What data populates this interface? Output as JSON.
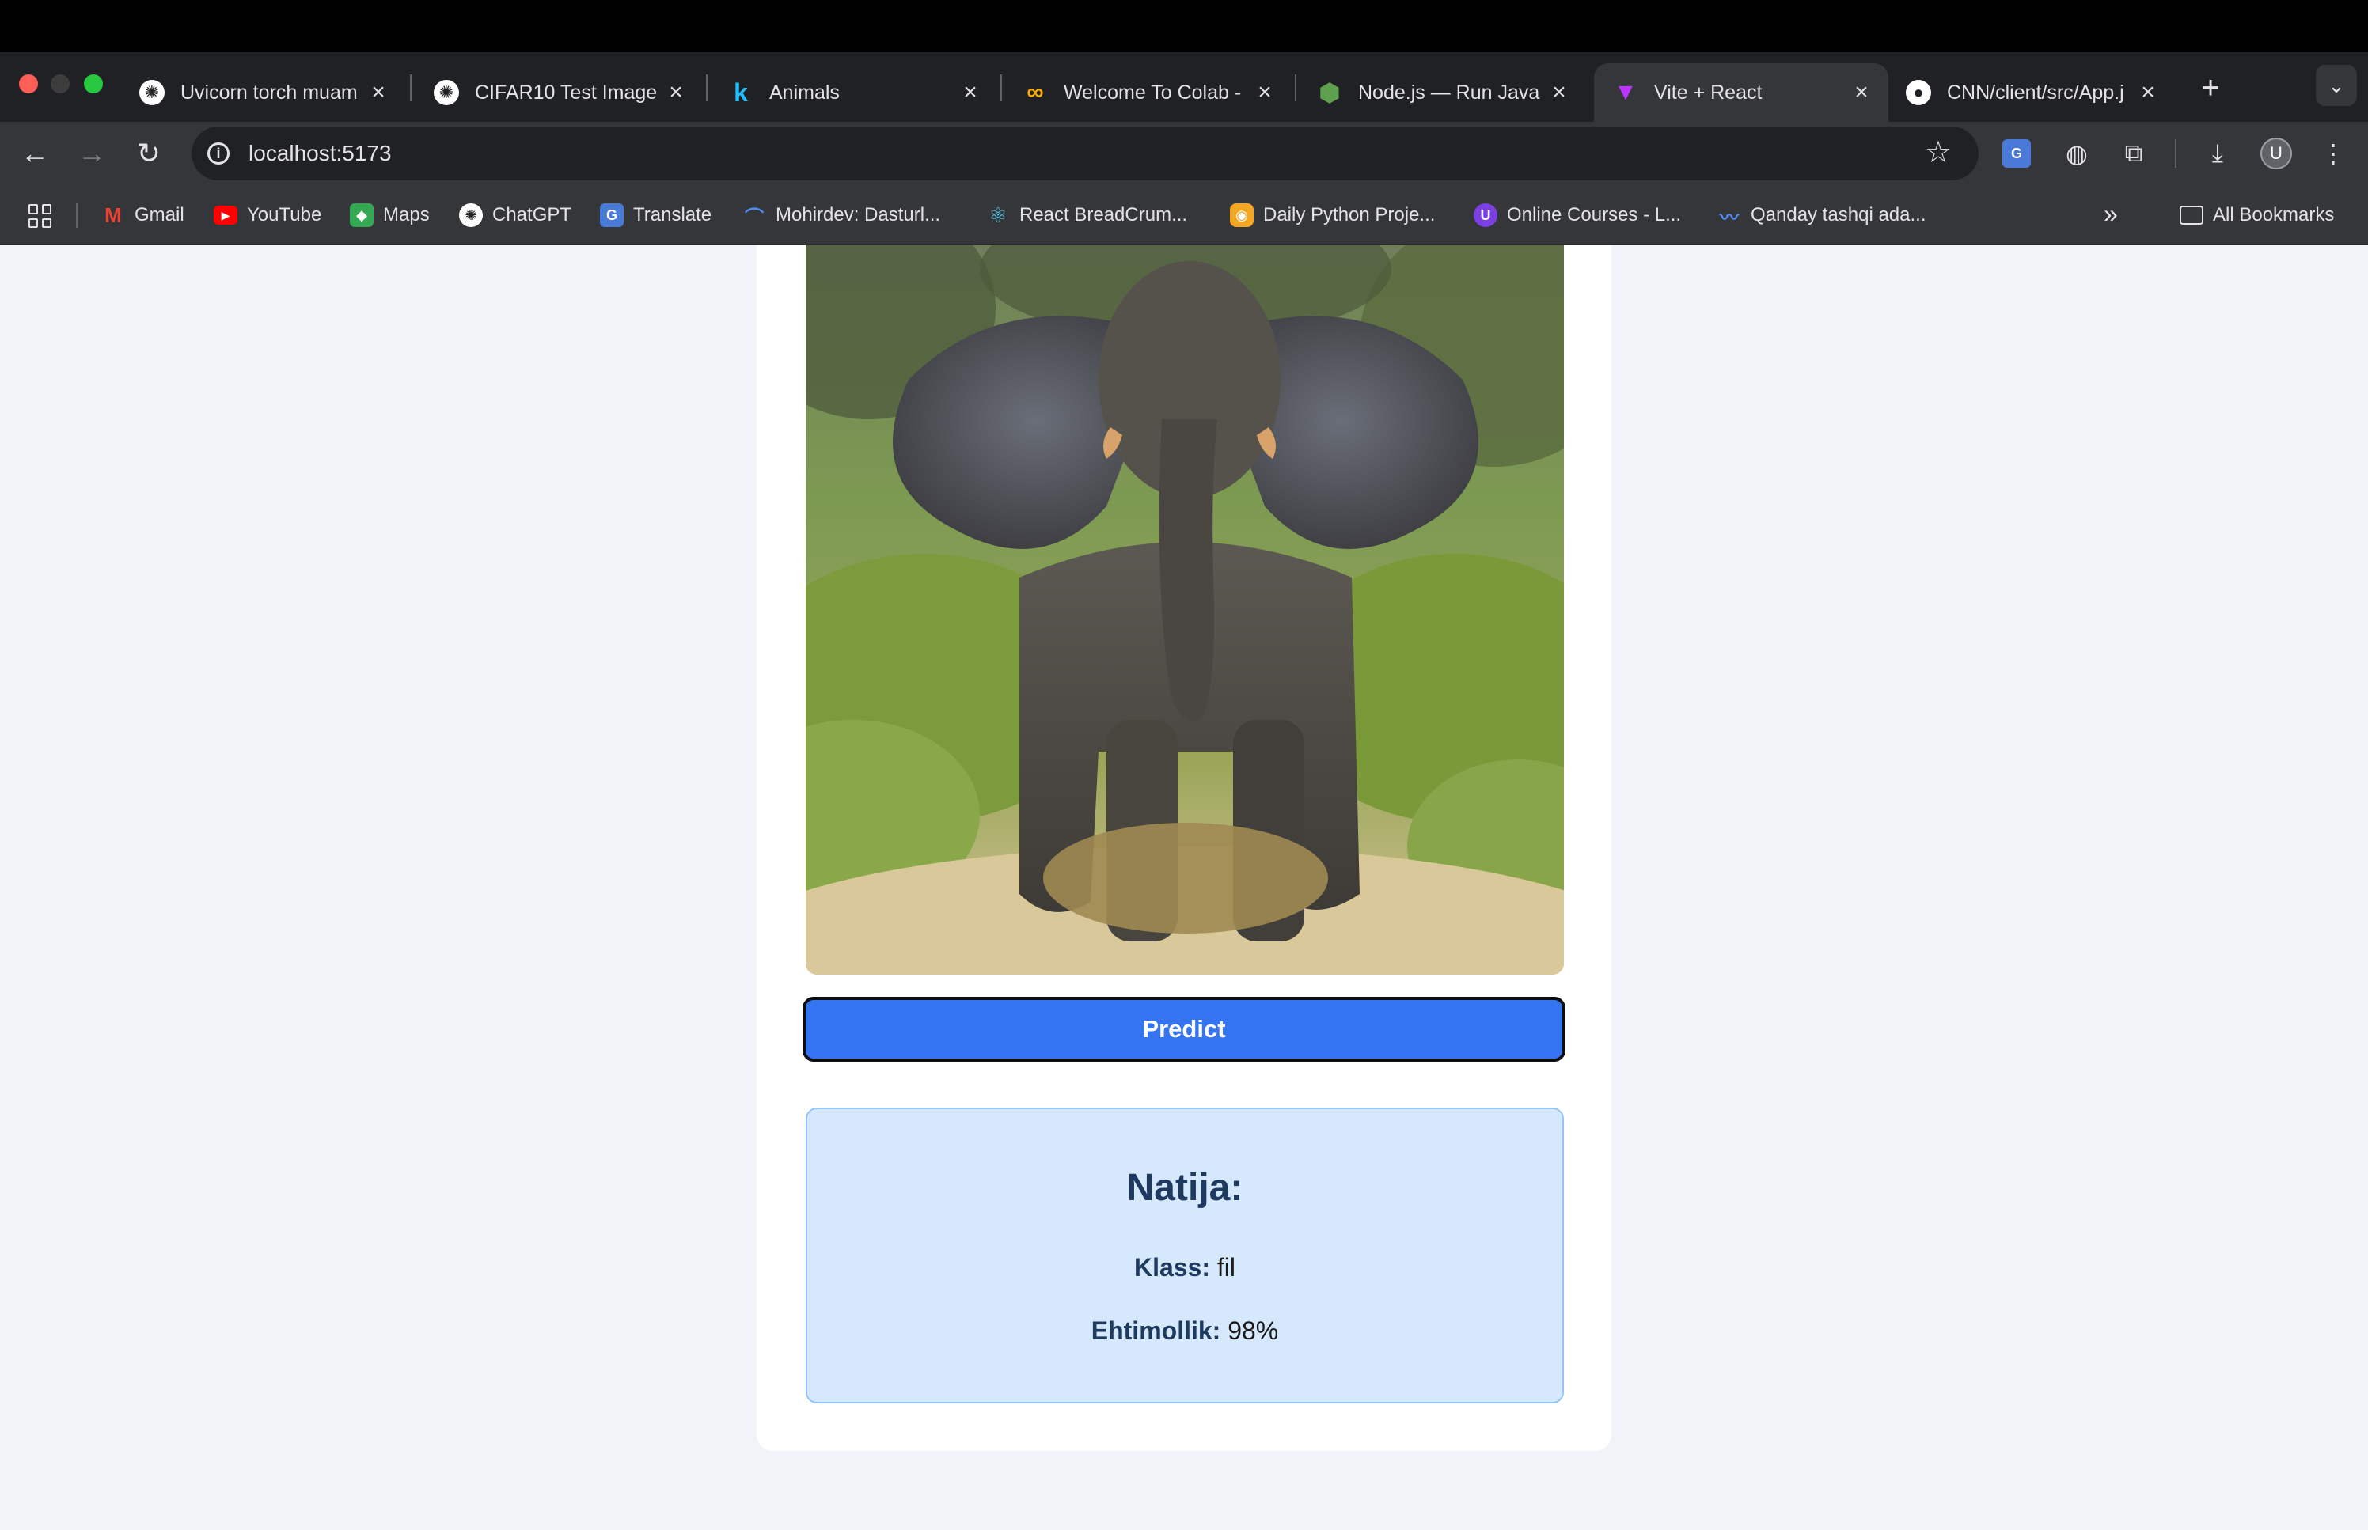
{
  "browser": {
    "tabs": [
      {
        "title": "Uvicorn torch muam",
        "favicon": "chatgpt-icon"
      },
      {
        "title": "CIFAR10 Test Image",
        "favicon": "chatgpt-icon"
      },
      {
        "title": "Animals",
        "favicon": "kaggle-icon"
      },
      {
        "title": "Welcome To Colab -",
        "favicon": "colab-icon"
      },
      {
        "title": "Node.js — Run Java",
        "favicon": "nodejs-icon"
      },
      {
        "title": "Vite + React",
        "favicon": "vite-icon",
        "active": true
      },
      {
        "title": "CNN/client/src/App.j",
        "favicon": "github-icon"
      }
    ],
    "url": "localhost:5173",
    "avatar_letter": "U",
    "bookmarks": [
      {
        "label": "Gmail",
        "icon": "gmail-icon"
      },
      {
        "label": "YouTube",
        "icon": "youtube-icon"
      },
      {
        "label": "Maps",
        "icon": "maps-icon"
      },
      {
        "label": "ChatGPT",
        "icon": "chatgpt-icon"
      },
      {
        "label": "Translate",
        "icon": "translate-icon"
      },
      {
        "label": "Mohirdev: Dasturl...",
        "icon": "mohirdev-icon"
      },
      {
        "label": "React BreadCrum...",
        "icon": "react-icon"
      },
      {
        "label": "Daily Python Proje...",
        "icon": "python-icon"
      },
      {
        "label": "Online Courses - L...",
        "icon": "courses-icon"
      },
      {
        "label": "Qanday tashqi ada...",
        "icon": "wave-icon"
      }
    ],
    "all_bookmarks_label": "All Bookmarks"
  },
  "app": {
    "predict_label": "Predict",
    "result": {
      "heading": "Natija:",
      "class_label": "Klass:",
      "class_value": "fil",
      "prob_label": "Ehtimollik:",
      "prob_value": "98%"
    }
  },
  "colors": {
    "button": "#3574f0",
    "result_bg": "#d6e8fb",
    "page_bg": "#f0f4f8"
  }
}
